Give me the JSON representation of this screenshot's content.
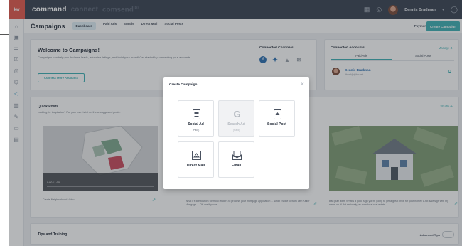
{
  "topbar": {
    "brand": "kw",
    "product_active": "command",
    "product_2": "connect",
    "product_3": "comsend",
    "product_3_sup": "(B)",
    "user_name": "Dennis Bradman"
  },
  "sidebar": {
    "icons": [
      "home-icon",
      "contacts-icon",
      "list-icon",
      "checklist-icon",
      "target-icon",
      "tag-icon",
      "campaigns-icon",
      "chart-icon",
      "edit-icon",
      "window-icon",
      "document-icon"
    ]
  },
  "header": {
    "title": "Campaigns",
    "tabs": [
      "Dashboard",
      "Paid Ads",
      "Emails",
      "Direct Mail",
      "Social Posts"
    ],
    "active_tab": "Dashboard",
    "payments": "Payments",
    "create_button": "Create Campaign"
  },
  "welcome": {
    "title": "Welcome to Campaigns!",
    "description": "Campaigns can help you find new leads, advertise listings, and build your brand! Get started by connecting your accounts.",
    "button": "Connect More Accounts",
    "channels_title": "Connected Channels"
  },
  "accounts": {
    "title": "Connected Accounts",
    "manage": "Manage",
    "tabs": [
      "Paid Ads",
      "Social Posts"
    ],
    "name": "Dennis Bradman",
    "email": "dbrad@@kw.net"
  },
  "quick_posts": {
    "title": "Quick Posts",
    "subtitle": "Looking for inspiration? Put your own twist on these suggested posts.",
    "shuffle": "Shuffle",
    "video_time": "0:00 / 1:00",
    "video_caption": "Create Neighborhood Video",
    "middle_caption": "What it's like to work for most lenders to process your mortgage application ... What it's like to work with Keller Mortgage ... OK me if you're...",
    "right_caption": "Bad plan alert! What's a good sign you're going to get a great price for your home? A for-sale sign with my name on it! But seriously, as your local real estate..."
  },
  "tips": {
    "title": "Tips and Training",
    "advanced": "Advanced Tips"
  },
  "modal": {
    "title": "Create Campaign",
    "options": [
      {
        "label": "Social Ad",
        "sub": "(Paid)",
        "icon": "social-ad-icon",
        "enabled": true
      },
      {
        "label": "Search Ad",
        "sub": "(Paid)",
        "icon": "google-icon",
        "enabled": false
      },
      {
        "label": "Social Post",
        "sub": "",
        "icon": "social-post-icon",
        "enabled": true
      },
      {
        "label": "Direct Mail",
        "sub": "",
        "icon": "mail-icon",
        "enabled": true
      },
      {
        "label": "Email",
        "sub": "",
        "icon": "email-icon",
        "enabled": true
      }
    ]
  },
  "colors": {
    "topbar": "#3a4352",
    "brand": "#e2584c",
    "accent": "#3eb0b4",
    "facebook": "#2b6fb1",
    "twitter": "#2b6fb1"
  }
}
